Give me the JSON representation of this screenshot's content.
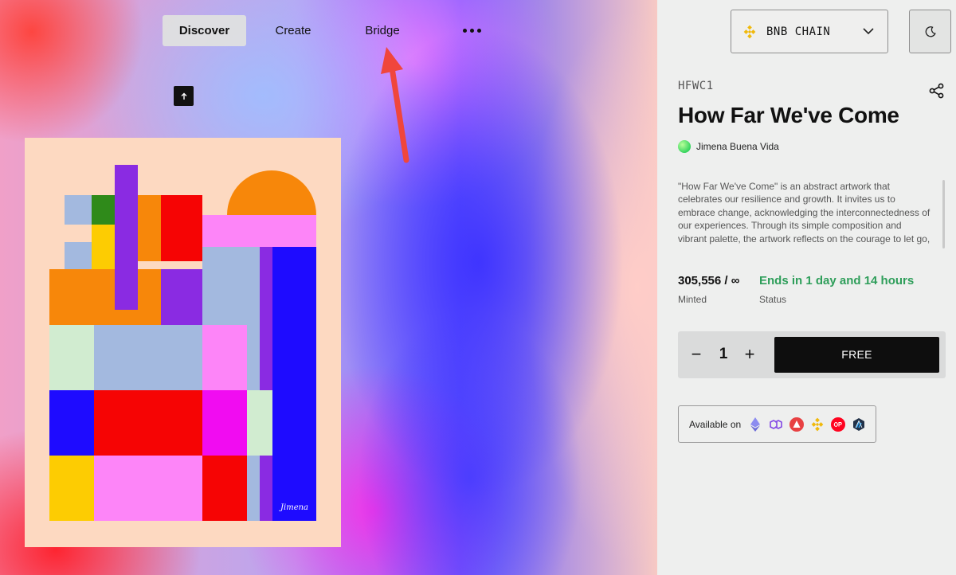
{
  "nav": {
    "tabs": [
      {
        "label": "Discover",
        "active": true
      },
      {
        "label": "Create"
      },
      {
        "label": "Bridge"
      }
    ],
    "more_icon": "more-dots-icon"
  },
  "chain_selector": {
    "label": "BNB CHAIN",
    "icon": "bnb-logo-icon",
    "color": "#f0b90b"
  },
  "theme_toggle": {
    "icon": "moon-icon"
  },
  "collection": {
    "symbol": "HFWC1",
    "title": "How Far We've Come",
    "creator": "Jimena Buena Vida",
    "description": "\"How Far We've Come\" is an abstract artwork that celebrates our resilience and growth. It invites us to embrace change, acknowledging the interconnectedness of our experiences. Through its simple composition and vibrant palette, the artwork reflects on the courage to let go, adapt, and appreciate the",
    "minted_count": "305,556 / ∞",
    "minted_label": "Minted",
    "status_value": "Ends in 1 day and 14 hours",
    "status_label": "Status",
    "status_color": "#2e9e5a"
  },
  "mint": {
    "quantity": "1",
    "minus": "−",
    "plus": "+",
    "button_label": "FREE"
  },
  "available": {
    "label": "Available on",
    "networks": [
      "ethereum-icon",
      "polygon-icon",
      "avalanche-icon",
      "bnb-icon",
      "optimism-icon",
      "arbitrum-icon"
    ]
  },
  "artwork": {
    "signature": "Jimena"
  }
}
